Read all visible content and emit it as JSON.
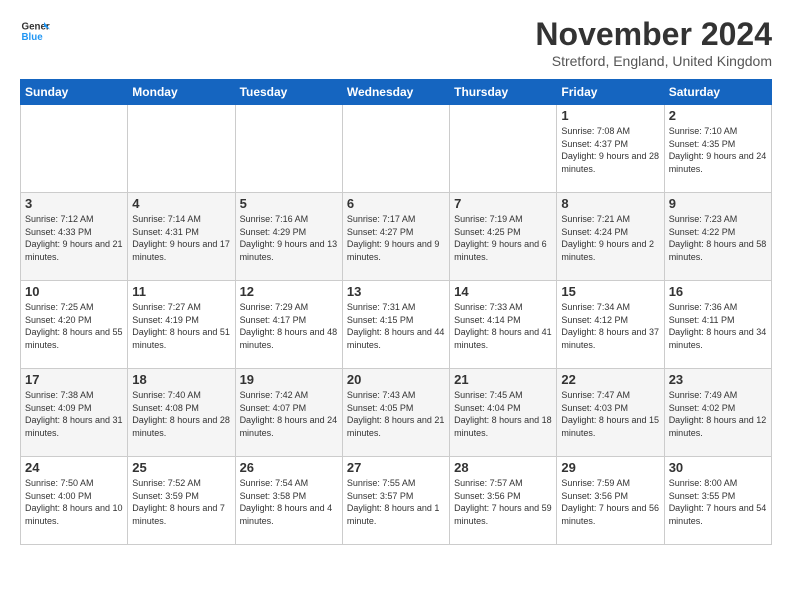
{
  "logo": {
    "line1": "General",
    "line2": "Blue"
  },
  "title": "November 2024",
  "location": "Stretford, England, United Kingdom",
  "days_of_week": [
    "Sunday",
    "Monday",
    "Tuesday",
    "Wednesday",
    "Thursday",
    "Friday",
    "Saturday"
  ],
  "weeks": [
    [
      {
        "day": "",
        "info": ""
      },
      {
        "day": "",
        "info": ""
      },
      {
        "day": "",
        "info": ""
      },
      {
        "day": "",
        "info": ""
      },
      {
        "day": "",
        "info": ""
      },
      {
        "day": "1",
        "info": "Sunrise: 7:08 AM\nSunset: 4:37 PM\nDaylight: 9 hours and 28 minutes."
      },
      {
        "day": "2",
        "info": "Sunrise: 7:10 AM\nSunset: 4:35 PM\nDaylight: 9 hours and 24 minutes."
      }
    ],
    [
      {
        "day": "3",
        "info": "Sunrise: 7:12 AM\nSunset: 4:33 PM\nDaylight: 9 hours and 21 minutes."
      },
      {
        "day": "4",
        "info": "Sunrise: 7:14 AM\nSunset: 4:31 PM\nDaylight: 9 hours and 17 minutes."
      },
      {
        "day": "5",
        "info": "Sunrise: 7:16 AM\nSunset: 4:29 PM\nDaylight: 9 hours and 13 minutes."
      },
      {
        "day": "6",
        "info": "Sunrise: 7:17 AM\nSunset: 4:27 PM\nDaylight: 9 hours and 9 minutes."
      },
      {
        "day": "7",
        "info": "Sunrise: 7:19 AM\nSunset: 4:25 PM\nDaylight: 9 hours and 6 minutes."
      },
      {
        "day": "8",
        "info": "Sunrise: 7:21 AM\nSunset: 4:24 PM\nDaylight: 9 hours and 2 minutes."
      },
      {
        "day": "9",
        "info": "Sunrise: 7:23 AM\nSunset: 4:22 PM\nDaylight: 8 hours and 58 minutes."
      }
    ],
    [
      {
        "day": "10",
        "info": "Sunrise: 7:25 AM\nSunset: 4:20 PM\nDaylight: 8 hours and 55 minutes."
      },
      {
        "day": "11",
        "info": "Sunrise: 7:27 AM\nSunset: 4:19 PM\nDaylight: 8 hours and 51 minutes."
      },
      {
        "day": "12",
        "info": "Sunrise: 7:29 AM\nSunset: 4:17 PM\nDaylight: 8 hours and 48 minutes."
      },
      {
        "day": "13",
        "info": "Sunrise: 7:31 AM\nSunset: 4:15 PM\nDaylight: 8 hours and 44 minutes."
      },
      {
        "day": "14",
        "info": "Sunrise: 7:33 AM\nSunset: 4:14 PM\nDaylight: 8 hours and 41 minutes."
      },
      {
        "day": "15",
        "info": "Sunrise: 7:34 AM\nSunset: 4:12 PM\nDaylight: 8 hours and 37 minutes."
      },
      {
        "day": "16",
        "info": "Sunrise: 7:36 AM\nSunset: 4:11 PM\nDaylight: 8 hours and 34 minutes."
      }
    ],
    [
      {
        "day": "17",
        "info": "Sunrise: 7:38 AM\nSunset: 4:09 PM\nDaylight: 8 hours and 31 minutes."
      },
      {
        "day": "18",
        "info": "Sunrise: 7:40 AM\nSunset: 4:08 PM\nDaylight: 8 hours and 28 minutes."
      },
      {
        "day": "19",
        "info": "Sunrise: 7:42 AM\nSunset: 4:07 PM\nDaylight: 8 hours and 24 minutes."
      },
      {
        "day": "20",
        "info": "Sunrise: 7:43 AM\nSunset: 4:05 PM\nDaylight: 8 hours and 21 minutes."
      },
      {
        "day": "21",
        "info": "Sunrise: 7:45 AM\nSunset: 4:04 PM\nDaylight: 8 hours and 18 minutes."
      },
      {
        "day": "22",
        "info": "Sunrise: 7:47 AM\nSunset: 4:03 PM\nDaylight: 8 hours and 15 minutes."
      },
      {
        "day": "23",
        "info": "Sunrise: 7:49 AM\nSunset: 4:02 PM\nDaylight: 8 hours and 12 minutes."
      }
    ],
    [
      {
        "day": "24",
        "info": "Sunrise: 7:50 AM\nSunset: 4:00 PM\nDaylight: 8 hours and 10 minutes."
      },
      {
        "day": "25",
        "info": "Sunrise: 7:52 AM\nSunset: 3:59 PM\nDaylight: 8 hours and 7 minutes."
      },
      {
        "day": "26",
        "info": "Sunrise: 7:54 AM\nSunset: 3:58 PM\nDaylight: 8 hours and 4 minutes."
      },
      {
        "day": "27",
        "info": "Sunrise: 7:55 AM\nSunset: 3:57 PM\nDaylight: 8 hours and 1 minute."
      },
      {
        "day": "28",
        "info": "Sunrise: 7:57 AM\nSunset: 3:56 PM\nDaylight: 7 hours and 59 minutes."
      },
      {
        "day": "29",
        "info": "Sunrise: 7:59 AM\nSunset: 3:56 PM\nDaylight: 7 hours and 56 minutes."
      },
      {
        "day": "30",
        "info": "Sunrise: 8:00 AM\nSunset: 3:55 PM\nDaylight: 7 hours and 54 minutes."
      }
    ]
  ]
}
